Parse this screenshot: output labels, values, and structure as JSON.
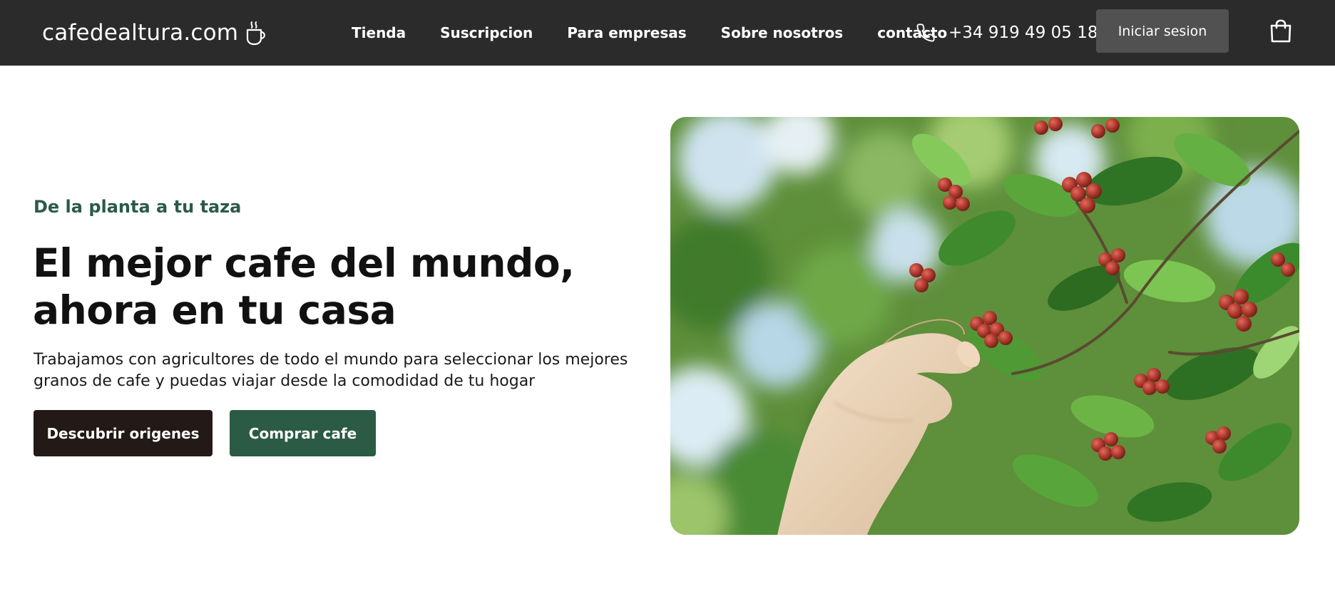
{
  "header": {
    "logo_text": "cafedealtura.com",
    "logo_icon": "coffee-cup-icon",
    "nav": [
      {
        "label": "Tienda"
      },
      {
        "label": "Suscripcion"
      },
      {
        "label": "Para empresas"
      },
      {
        "label": "Sobre nosotros"
      },
      {
        "label": "contacto"
      }
    ],
    "phone_icon": "phone-icon",
    "phone": "+34 919 49 05 18",
    "login_label": "Iniciar sesion",
    "cart_icon": "shopping-bag-icon"
  },
  "hero": {
    "eyebrow": "De la planta a tu taza",
    "title_line1": "El mejor cafe del mundo,",
    "title_line2": "ahora en tu casa",
    "desc_line1": "Trabajamos con agricultores de todo el mundo para seleccionar los mejores",
    "desc_line2": "granos de cafe y puedas viajar desde la comodidad de tu hogar",
    "primary_label": "Descubrir origenes",
    "secondary_label": "Comprar cafe",
    "image_subject": "hand picking red coffee cherries from a green coffee plant"
  },
  "colors": {
    "header_bg": "#2b2b2b",
    "login_bg": "#515151",
    "accent_green": "#2b5b45",
    "dark_button": "#231a17"
  }
}
